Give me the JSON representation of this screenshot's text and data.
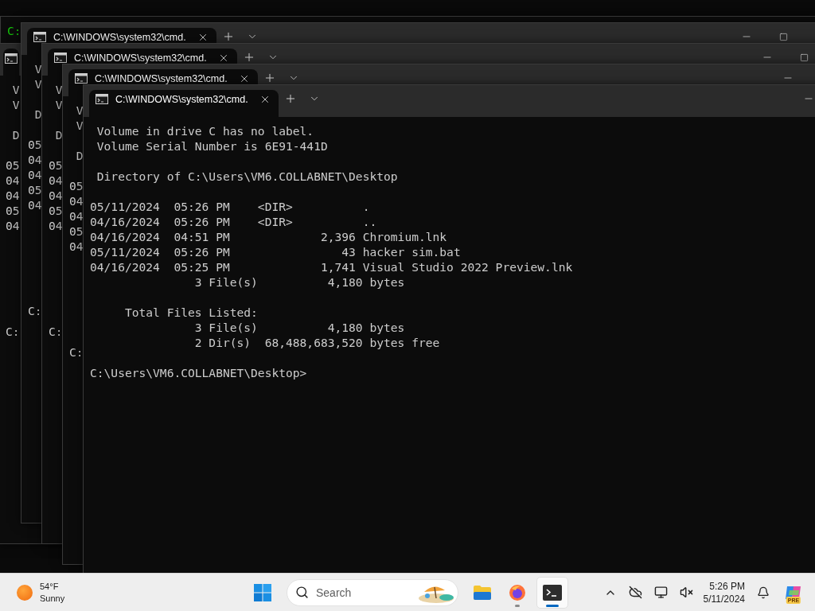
{
  "windows": [
    {
      "tab": false,
      "color": "#16c60c",
      "blocks": [
        {
          "kind": "volume",
          "lines": [
            "C:"
          ]
        }
      ]
    },
    {
      "tab": true,
      "blocks": [
        {
          "kind": "volume",
          "lines": [
            " V",
            " V"
          ]
        },
        {
          "kind": "directory",
          "lines": [
            " D"
          ]
        },
        {
          "kind": "listing",
          "lines": [
            "05",
            "04",
            "04",
            "05",
            "04"
          ]
        },
        {
          "kind": "prompt",
          "lines": [
            "C:"
          ]
        }
      ]
    },
    {
      "tab": true,
      "tab_title": "C:\\WINDOWS\\system32\\cmd.",
      "new_tab": true,
      "controls": [
        {
          "kind": "minimize"
        },
        {
          "kind": "maximize"
        }
      ],
      "blocks": [
        {
          "kind": "volume",
          "lines": [
            " V",
            " V"
          ]
        },
        {
          "kind": "directory",
          "lines": [
            " D"
          ]
        },
        {
          "kind": "listing",
          "lines": [
            "05",
            "04",
            "04",
            "05",
            "04"
          ]
        },
        {
          "kind": "prompt",
          "lines": [
            "C:"
          ]
        }
      ]
    },
    {
      "tab": true,
      "tab_title": "C:\\WINDOWS\\system32\\cmd.",
      "new_tab": true,
      "controls": [
        {
          "kind": "minimize"
        },
        {
          "kind": "maximize"
        }
      ],
      "blocks": [
        {
          "kind": "volume",
          "lines": [
            " V",
            " V"
          ]
        },
        {
          "kind": "directory",
          "lines": [
            " D"
          ]
        },
        {
          "kind": "listing",
          "lines": [
            "05",
            "04",
            "04",
            "05",
            "04"
          ]
        },
        {
          "kind": "prompt",
          "lines": [
            "C:"
          ]
        }
      ]
    },
    {
      "tab": true,
      "tab_title": "C:\\WINDOWS\\system32\\cmd.",
      "new_tab": true,
      "controls": [
        {
          "kind": "minimize"
        }
      ],
      "blocks": [
        {
          "kind": "volume",
          "lines": [
            " V",
            " V"
          ]
        },
        {
          "kind": "directory",
          "lines": [
            " D"
          ]
        },
        {
          "kind": "listing",
          "lines": [
            "05",
            "04",
            "04",
            "05",
            "04"
          ]
        },
        {
          "kind": "prompt",
          "lines": [
            "C:"
          ]
        }
      ]
    },
    {
      "tab": true,
      "tab_title": "C:\\WINDOWS\\system32\\cmd.",
      "new_tab": true,
      "controls": [
        {
          "kind": "minimize"
        }
      ],
      "blocks": [
        {
          "kind": "volume",
          "lines": [
            " Volume in drive C has no label.",
            " Volume Serial Number is 6E91-441D"
          ]
        },
        {
          "kind": "directory",
          "lines": [
            " Directory of C:\\Users\\VM6.COLLABNET\\Desktop"
          ]
        },
        {
          "kind": "listing",
          "lines": [
            "05/11/2024  05:26 PM    <DIR>          .",
            "04/16/2024  05:26 PM    <DIR>          ..",
            "04/16/2024  04:51 PM             2,396 Chromium.lnk",
            "05/11/2024  05:26 PM                43 hacker sim.bat",
            "04/16/2024  05:25 PM             1,741 Visual Studio 2022 Preview.lnk",
            "               3 File(s)          4,180 bytes"
          ]
        },
        {
          "kind": "totals",
          "lines": [
            "     Total Files Listed:",
            "               3 File(s)          4,180 bytes",
            "               2 Dir(s)  68,488,683,520 bytes free"
          ]
        },
        {
          "kind": "prompt",
          "lines": [
            "C:\\Users\\VM6.COLLABNET\\Desktop>"
          ]
        }
      ]
    }
  ],
  "taskbar": {
    "weather": {
      "temperature": "54°F",
      "condition": "Sunny"
    },
    "search": {
      "placeholder": "Search"
    },
    "apps": [
      {
        "kind": "explorer",
        "running": false,
        "selected": false
      },
      {
        "kind": "firefox",
        "running": true,
        "selected": false
      },
      {
        "kind": "terminal",
        "running": true,
        "selected": true
      }
    ],
    "clock": {
      "time": "5:26 PM",
      "date": "5/11/2024"
    },
    "copilot": {
      "badge": "PRE"
    }
  }
}
